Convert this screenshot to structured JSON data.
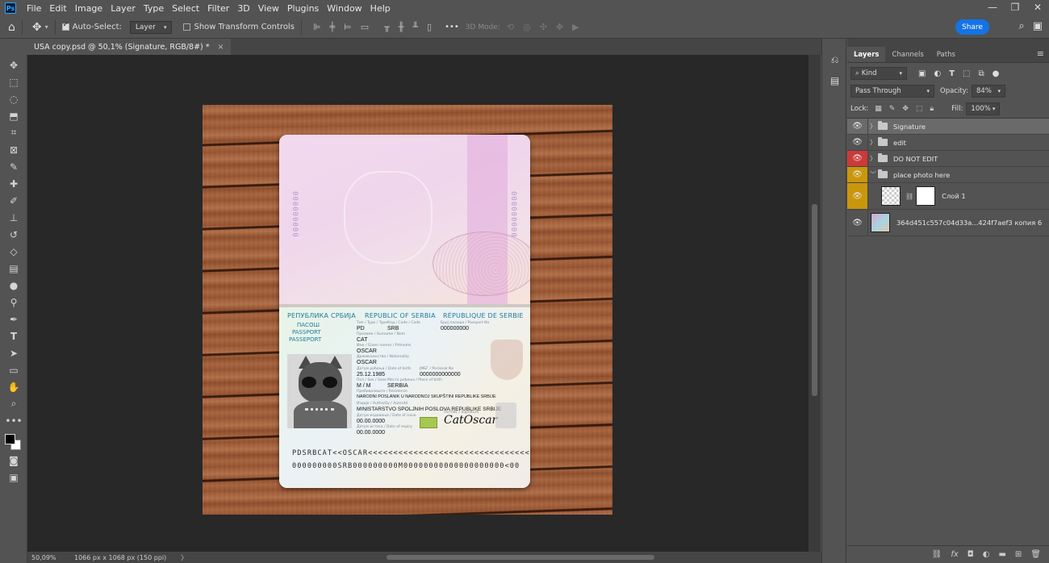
{
  "app": {
    "logo": "Ps"
  },
  "menu": [
    "File",
    "Edit",
    "Image",
    "Layer",
    "Type",
    "Select",
    "Filter",
    "3D",
    "View",
    "Plugins",
    "Window",
    "Help"
  ],
  "window_controls": {
    "minimize": "—",
    "restore": "❐",
    "close": "✕"
  },
  "options": {
    "auto_select_label": "Auto-Select:",
    "auto_select_checked": true,
    "target_select": "Layer",
    "show_transform_label": "Show Transform Controls",
    "show_transform_checked": false,
    "more": "•••",
    "mode3d_label": "3D Mode:",
    "share_label": "Share"
  },
  "document": {
    "tab_title": "USA  copy.psd @ 50,1% (Signature, RGB/8#) *",
    "close": "×"
  },
  "status": {
    "zoom": "50,09%",
    "dims": "1066 px x 1068 px (150 ppi)",
    "arrow": "〉"
  },
  "passport": {
    "serial_vertical": "000000000",
    "header_cyr": "РЕПУБЛИКА СРБИЈА",
    "header_en": "REPUBLIC OF SERBIA",
    "header_fr": "RÉPUBLIQUE DE SERBIE",
    "doc_cyr": "ПАСОШ",
    "doc_en": "PASSPORT",
    "doc_fr": "PASSEPORT",
    "lbl_type": "Тип / Type / Type",
    "lbl_code": "Код / Code / Code",
    "lbl_passport_no": "Број пасоша / Passport No",
    "lbl_surname": "Презиме / Surname / Nom",
    "lbl_given": "Име / Given names / Prénoms",
    "lbl_nationality": "Држављанство / Nationality",
    "lbl_dob": "Датум рођења / Date of birth",
    "lbl_id": "ЈМБГ / Personal No",
    "lbl_sex": "Пол / Sex / Sexe",
    "lbl_pob": "Место рођења / Place of birth",
    "lbl_residence": "Пребивалиште / Residence",
    "lbl_authority": "Издаје / Authority / Autorité",
    "lbl_issue": "Датум издавања / Date of issue",
    "lbl_expiry": "Датум истека / Date of expiry",
    "lbl_signature": "Потпис / Signature",
    "type": "PD",
    "code": "SRB",
    "passport_no": "000000000",
    "surname": "CAT",
    "given_names": "OSCAR",
    "nationality": "OSCAR",
    "dob": "25.12.1985",
    "personal_no": "0000000000000",
    "sex": "M / M",
    "place_of_birth": "SERBIA",
    "residence": "NARODNI POSLANIK U NARODNOJ SKUPŠTINI REPUBLIKE SRBIJE",
    "authority": "MINISTARSTVO SPOLJNIH POSLOVA REPUBLIKE SRBIJE",
    "issue_date": "00.00.0000",
    "expiry_date": "00.00.0000",
    "signature": "CatOscar",
    "mrz1": "PDSRBCAT<<OSCAR<<<<<<<<<<<<<<<<<<<<<<<<<<<<<<<<",
    "mrz2": "000000000SRB000000000M00000000000000000000<00"
  },
  "panel": {
    "tabs": [
      "Layers",
      "Channels",
      "Paths"
    ],
    "active_tab": "Layers",
    "menu_icon": "≡",
    "filter_kind": "Kind",
    "blend_mode": "Pass Through",
    "opacity_label": "Opacity:",
    "opacity_value": "84%",
    "lock_label": "Lock:",
    "fill_label": "Fill:",
    "fill_value": "100%",
    "layers": [
      {
        "name": "Signature",
        "type": "group",
        "expanded": false,
        "selected": true,
        "eye_color": ""
      },
      {
        "name": "edit",
        "type": "group",
        "expanded": false,
        "selected": false,
        "eye_color": ""
      },
      {
        "name": "DO NOT EDIT",
        "type": "group",
        "expanded": false,
        "selected": false,
        "eye_color": "#cc3a3a"
      },
      {
        "name": "place photo here",
        "type": "group",
        "expanded": true,
        "selected": false,
        "eye_color": "#c9960c"
      },
      {
        "name": "Слой 1",
        "type": "layer-mask",
        "selected": false,
        "eye_color": "#c9960c"
      },
      {
        "name": "364d451c557c04d33a...424f7aef3 копия 6",
        "type": "image",
        "selected": false,
        "eye_color": ""
      }
    ]
  },
  "colors": {
    "accent": "#1473e6",
    "canvas_bg": "#282828",
    "ui_bg": "#535353"
  }
}
